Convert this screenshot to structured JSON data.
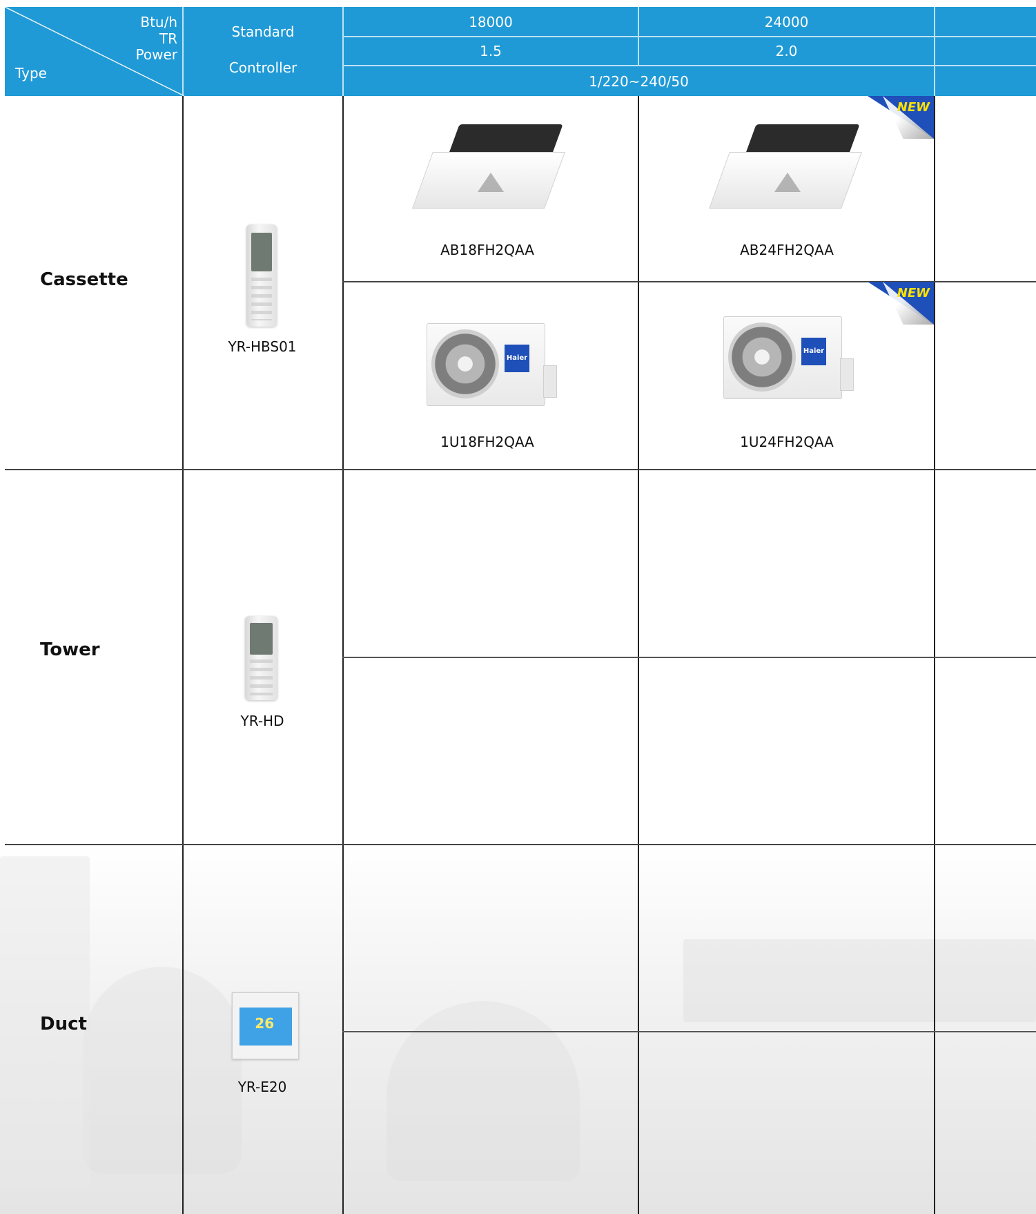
{
  "header": {
    "btuh": "Btu/h",
    "tr": "TR",
    "power": "Power",
    "type": "Type",
    "standard": "Standard",
    "controller": "Controller",
    "col1_btu": "18000",
    "col2_btu": "24000",
    "col1_tr": "1.5",
    "col2_tr": "2.0",
    "power_value": "1/220~240/50"
  },
  "rows": {
    "cassette": {
      "type": "Cassette",
      "controller": "YR-HBS01",
      "indoor_18": "AB18FH2QAA",
      "indoor_24": "AB24FH2QAA",
      "outdoor_18": "1U18FH2QAA",
      "outdoor_24": "1U24FH2QAA"
    },
    "tower": {
      "type": "Tower",
      "controller": "YR-HD"
    },
    "duct": {
      "type": "Duct",
      "controller": "YR-E20"
    }
  },
  "badges": {
    "new": "NEW"
  },
  "images": {
    "outdoor_logo": "Haier",
    "pad_display": "26"
  },
  "colors": {
    "header_bg": "#1f9ad6",
    "badge_bg": "#1f4fb8",
    "badge_text": "#ffe100"
  }
}
